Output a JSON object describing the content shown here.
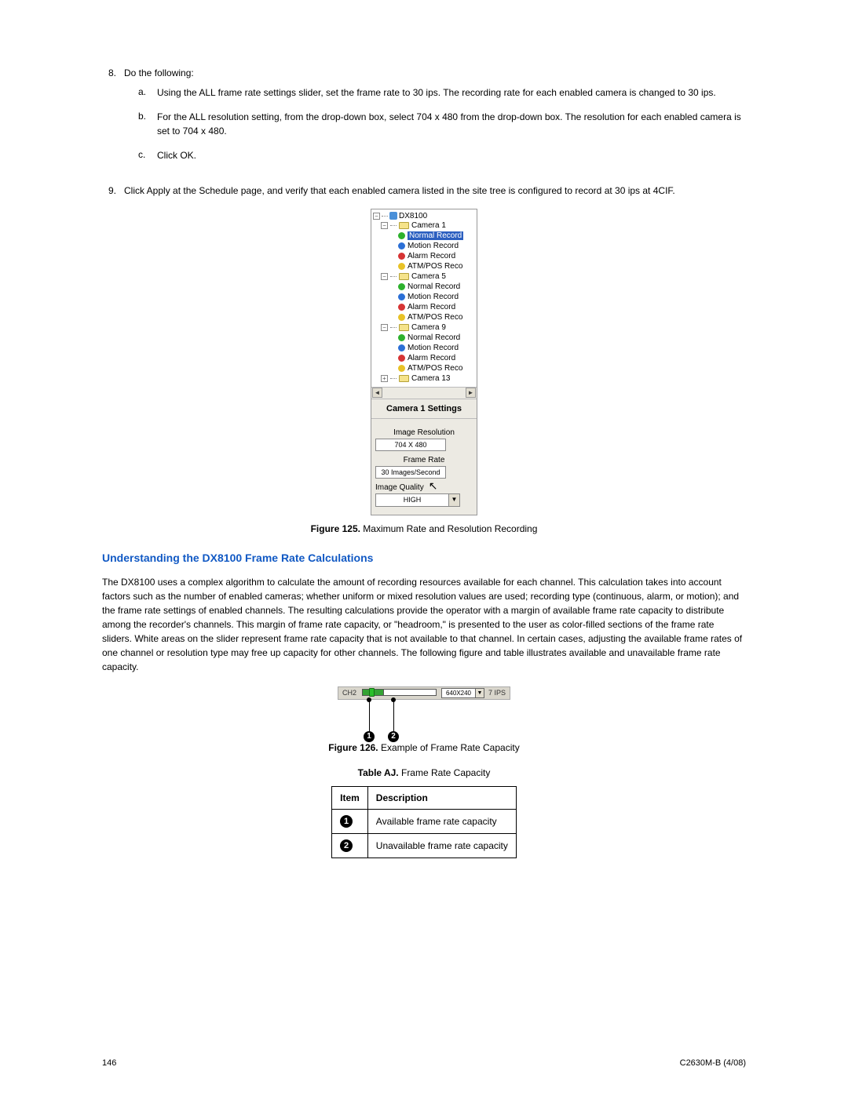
{
  "steps": {
    "s8": {
      "num": "8.",
      "text": "Do the following:"
    },
    "s8a": {
      "letter": "a.",
      "text": "Using the ALL frame rate settings slider, set the frame rate to 30 ips. The recording rate for each enabled camera is changed to 30 ips."
    },
    "s8b": {
      "letter": "b.",
      "text": "For the ALL resolution setting, from the drop-down box, select 704 x 480 from the drop-down box. The resolution for each enabled camera is set to 704 x 480."
    },
    "s8c": {
      "letter": "c.",
      "text": "Click OK."
    },
    "s9": {
      "num": "9.",
      "text": "Click Apply at the Schedule page, and verify that each enabled camera listed in the site tree is configured to record at 30 ips at 4CIF."
    }
  },
  "tree": {
    "root": "DX8100",
    "cam1": "Camera 1",
    "cam5": "Camera 5",
    "cam9": "Camera 9",
    "cam13": "Camera 13",
    "normal": "Normal Record",
    "motion": "Motion Record",
    "alarm": "Alarm Record",
    "atm": "ATM/POS Reco"
  },
  "settings": {
    "title": "Camera 1 Settings",
    "res_label": "Image Resolution",
    "res_value": "704 X 480",
    "fr_label": "Frame Rate",
    "fr_value": "30 Images/Second",
    "iq_label": "Image Quality",
    "iq_value": "HIGH"
  },
  "fig125": {
    "label": "Figure 125.",
    "caption": "Maximum Rate and Resolution Recording"
  },
  "heading": "Understanding the DX8100 Frame Rate Calculations",
  "para1": "The DX8100 uses a complex algorithm to calculate the amount of recording resources available for each channel. This calculation takes into account factors such as the number of enabled cameras; whether uniform or mixed resolution values are used; recording type (continuous, alarm, or motion); and the frame rate settings of enabled channels. The resulting calculations provide the operator with a margin of available frame rate capacity to distribute among the recorder's channels. This margin of frame rate capacity, or \"headroom,\" is presented to the user as color-filled sections of the frame rate sliders. White areas on the slider represent frame rate capacity that is not available to that channel. In certain cases, adjusting the available frame rates of one channel or resolution type may free up capacity for other channels. The following figure and table illustrates available and unavailable frame rate capacity.",
  "slider": {
    "channel": "CH2",
    "resolution": "640X240",
    "ips": "7 IPS",
    "callout1": "1",
    "callout2": "2"
  },
  "fig126": {
    "label": "Figure 126.",
    "caption": "Example of Frame Rate Capacity"
  },
  "tableaj": {
    "caption_label": "Table AJ.",
    "caption_text": "Frame Rate Capacity",
    "h1": "Item",
    "h2": "Description",
    "r1_item": "1",
    "r1_desc": "Available frame rate capacity",
    "r2_item": "2",
    "r2_desc": "Unavailable frame rate capacity"
  },
  "footer": {
    "page": "146",
    "doc": "C2630M-B (4/08)"
  }
}
